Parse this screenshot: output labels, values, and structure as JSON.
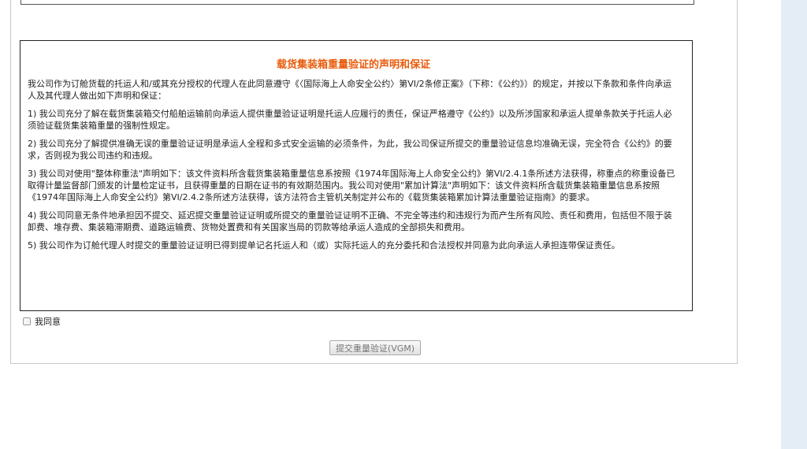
{
  "declaration": {
    "title": "载货集装箱重量验证的声明和保证",
    "intro": "我公司作为订舱货载的托运人和/或其充分授权的代理人在此同意遵守《〈国际海上人命安全公约〉第VI/2条修正案》（下称：《公约》）的规定，并按以下条款和条件向承运人及其代理人做出如下声明和保证：",
    "items": [
      "1) 我公司充分了解在载货集装箱交付船舶运输前向承运人提供重量验证证明是托运人应履行的责任，保证严格遵守《公约》以及所涉国家和承运人提单条款关于托运人必须验证载货集装箱重量的强制性规定。",
      "2) 我公司充分了解提供准确无误的重量验证证明是承运人全程和多式安全运输的必须条件，为此，我公司保证所提交的重量验证信息均准确无误，完全符合《公约》的要求，否则视为我公司违约和违规。",
      "3) 我公司对使用\"整体称重法\"声明如下：该文件资料所含载货集装箱重量信息系按照《1974年国际海上人命安全公约》第VI/2.4.1条所述方法获得，称重点的称重设备已取得计量监督部门颁发的计量检定证书，且获得重量的日期在证书的有效期范围内。我公司对使用\"累加计算法\"声明如下：该文件资料所含载货集装箱重量信息系按照《1974年国际海上人命安全公约》第VI/2.4.2条所述方法获得，该方法符合主管机关制定并公布的《载货集装箱累加计算法重量验证指南》的要求。",
      "4) 我公司同意无条件地承担因不提交、延迟提交重量验证证明或所提交的重量验证证明不正确、不完全等违约和违规行为而产生所有风险、责任和费用，包括但不限于装卸费、堆存费、集装箱滞期费、道路运输费、货物处置费和有关国家当局的罚款等给承运人造成的全部损失和费用。",
      "5) 我公司作为订舱代理人时提交的重量验证证明已得到提单记名托运人和（或）实际托运人的充分委托和合法授权并同意为此向承运人承担连带保证责任。"
    ]
  },
  "agree": {
    "label": "我同意",
    "checked": false
  },
  "submit": {
    "label": "提交重量验证(VGM)"
  },
  "colors": {
    "title": "#e85c0c",
    "side_panel": "#e4edf5"
  }
}
